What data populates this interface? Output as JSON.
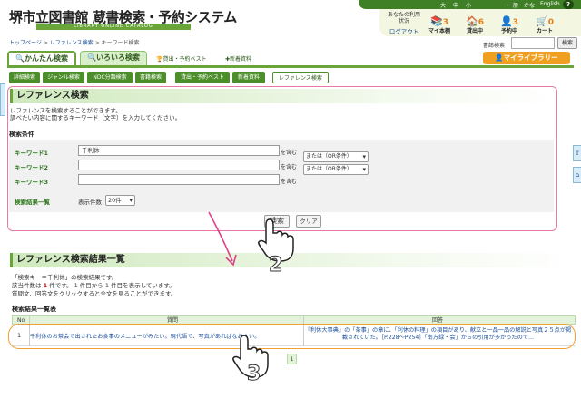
{
  "header": {
    "title": "堺市立図書館 蔵書検索・予約システム",
    "subtitle": "LIBRARY ONLINE CATALOG",
    "top_links": [
      "大",
      "中",
      "小",
      "一般",
      "かな",
      "English"
    ],
    "help": "?",
    "status_label": "あなたの利用状況",
    "logout": "ログアウト",
    "items": [
      {
        "label": "マイ本棚",
        "count": "3"
      },
      {
        "label": "貸出中",
        "count": "6"
      },
      {
        "label": "予約中",
        "count": "3"
      },
      {
        "label": "カート",
        "count": "0"
      }
    ]
  },
  "breadcrumb": {
    "home": "トップページ",
    "sep": ">",
    "ref": "レファレンス検索",
    "current": "キーワード検索"
  },
  "catalog": {
    "label": "書誌検索",
    "button": "検索"
  },
  "tabs": {
    "easy": "かんたん検索",
    "various": "いろいろ検索",
    "best": "貸出・予約ベスト",
    "new": "新着資料",
    "mylib": "マイライブラリー"
  },
  "subnav": [
    "詳細検索",
    "ジャンル検索",
    "NDC分類検索",
    "書籍検索",
    "貸出・予約ベスト",
    "新着資料",
    "レファレンス検索"
  ],
  "search": {
    "title": "レファレンス検索",
    "desc1": "レファレンスを検索することができます。",
    "desc2": "調べたい内容に関するキーワード（文字）を入力してください。",
    "cond_label": "検索条件",
    "keywords": [
      {
        "label": "キーワード1",
        "value": "千利休",
        "suffix": "を含む",
        "op": "または（OR条件）"
      },
      {
        "label": "キーワード2",
        "value": "",
        "suffix": "を含む",
        "op": "または（OR条件）"
      },
      {
        "label": "キーワード3",
        "value": "",
        "suffix": "を含む",
        "op": ""
      }
    ],
    "list_label": "検索結果一覧",
    "disp_label": "表示件数",
    "disp_value": "20件",
    "search_btn": "検索",
    "clear_btn": "クリア"
  },
  "results": {
    "title": "レファレンス検索結果一覧",
    "line1": "「検索キー＝千利休」の検索結果です。",
    "line2_a": "該当件数は",
    "line2_num": "1",
    "line2_b": "件です。 1 件目から 1 件目を表示しています。",
    "line3": "質問文、回答文をクリックすると全文を見ることができます。",
    "list_label": "検索結果一覧表",
    "col_no": "No",
    "col_q": "質問",
    "col_a": "回答",
    "rows": [
      {
        "no": "1",
        "q": "千利休のお茶会で出されたお食事のメニューがみたい。現代語で、写真があればなおよい。",
        "a": "『利休大事典』の「茶事」の章に、「利休の料理」の項目があり、献立と一品一品の解説と写真２５点が掲載されていた。［P.228〜P254］「南方録・会」からの引用が多かったので…"
      }
    ],
    "page": "1"
  },
  "steps": [
    "2",
    "3"
  ]
}
